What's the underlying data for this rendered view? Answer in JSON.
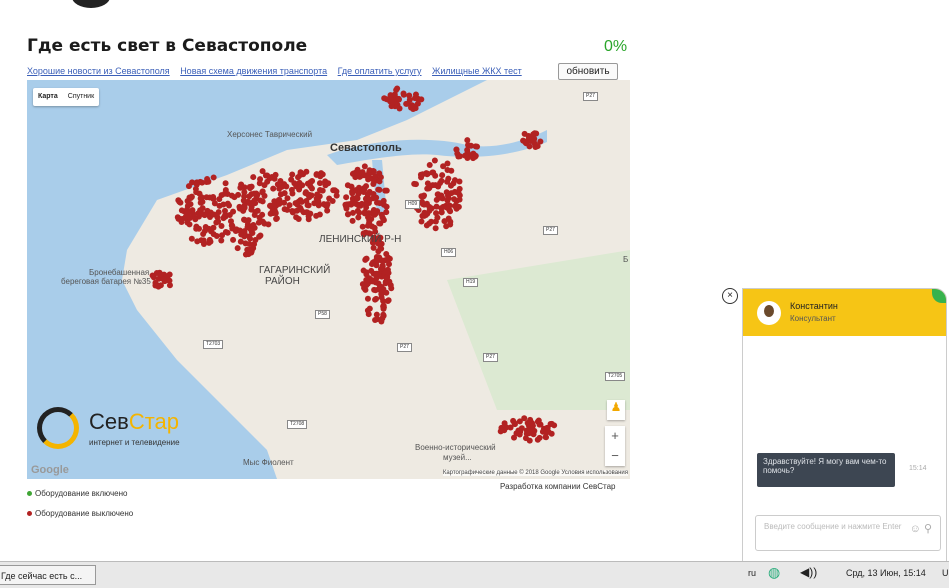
{
  "page": {
    "title": "Где есть свет в Севастополе",
    "percent": "0%",
    "links": [
      "Хорошие новости из Севастополя",
      "Новая схема движения транспорта",
      "Где оплатить услугу",
      "Жилищные ЖКХ тест"
    ],
    "refresh_label": "обновить"
  },
  "map": {
    "type_buttons": [
      "Карта",
      "Спутник"
    ],
    "labels": {
      "khersones": "Херсонес Таврический",
      "city": "Севастополь",
      "lenin": "ЛЕНИНСКИЙ Р-Н",
      "gagarin1": "ГАГАРИНСКИЙ",
      "gagarin2": "РАЙОН",
      "battery1": "Бронебашенная",
      "battery2": "береговая батарея №35",
      "museum1": "Военно-исторический",
      "museum2": "музей...",
      "cape": "Мыс Фиолент",
      "b": "Б"
    },
    "roads": [
      "P27",
      "H09",
      "H06",
      "H19",
      "P58",
      "P27",
      "T2703",
      "P27",
      "T2705",
      "T2708",
      "P27"
    ],
    "google": "Google",
    "attribution": "Картографические данные © 2018 Google  Условия использования",
    "zoom_in": "+",
    "zoom_out": "−"
  },
  "brand": {
    "name_a": "Сев",
    "name_b": "Стар",
    "tagline": "интернет и телевидение"
  },
  "developer": "Разработка компании СевСтар",
  "legend": [
    {
      "label": "Оборудование включено",
      "color": "#3fa535"
    },
    {
      "label": "Оборудование выключено",
      "color": "#b22222"
    }
  ],
  "chat": {
    "close": "×",
    "agent_name": "Константин",
    "agent_role": "Консультант",
    "message": "Здравствуйте! Я могу вам чем-то помочь?",
    "time": "15:14",
    "input_placeholder": "Введите сообщение и нажмите Enter",
    "accent": "#f6c515"
  },
  "taskbar": {
    "task": "Где сейчас есть с...",
    "lang": "ru",
    "datetime": "Срд, 13 Июн, 15:14",
    "user": "U"
  }
}
